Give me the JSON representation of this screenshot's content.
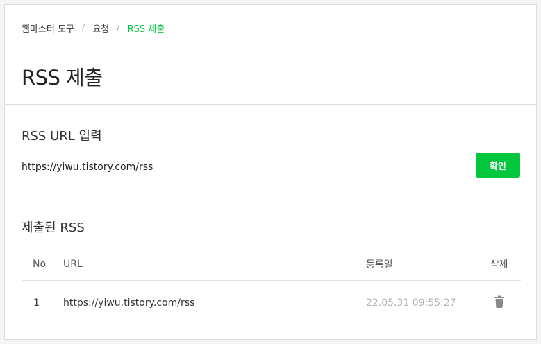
{
  "breadcrumb": {
    "items": [
      "웹마스터 도구",
      "요청"
    ],
    "current": "RSS 제출",
    "separator": "/"
  },
  "page_title": "RSS 제출",
  "rss_input": {
    "section_title": "RSS URL 입력",
    "value": "https://yiwu.tistory.com/rss",
    "button_label": "확인"
  },
  "submitted": {
    "section_title": "제출된 RSS",
    "columns": {
      "no": "No",
      "url": "URL",
      "date": "등록일",
      "delete": "삭제"
    },
    "rows": [
      {
        "no": "1",
        "url": "https://yiwu.tistory.com/rss",
        "date": "22.05.31 09:55:27",
        "delete_icon": "trash-icon"
      }
    ]
  },
  "colors": {
    "accent": "#00c73c",
    "date_text": "#b3b3b3",
    "trash_icon": "#888888"
  }
}
